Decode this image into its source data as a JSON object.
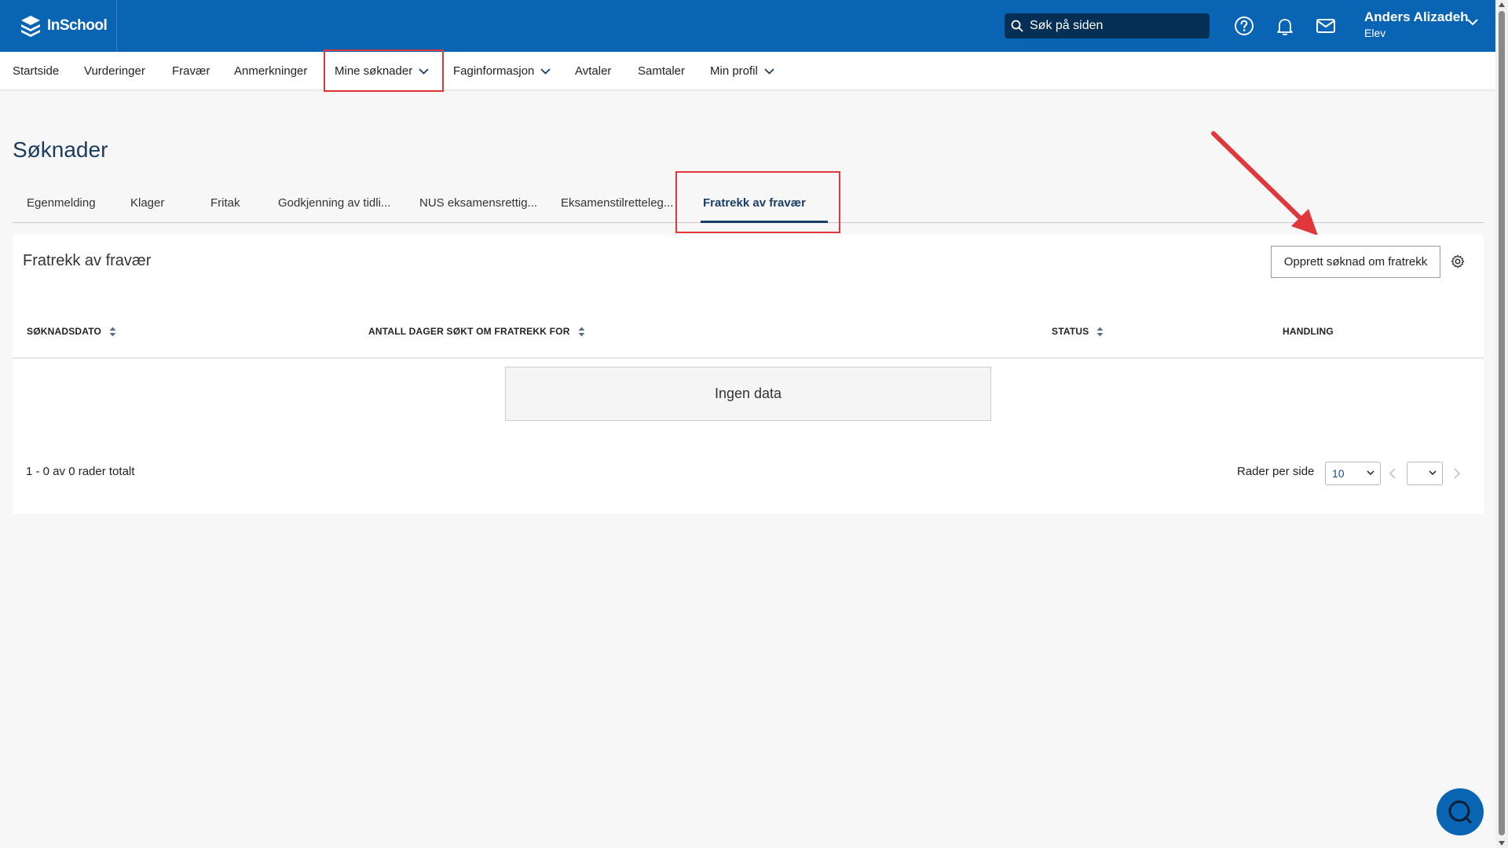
{
  "app": {
    "logo_text": "InSchool",
    "search_placeholder": "Søk på siden",
    "user_name": "Anders Alizadeh",
    "user_role": "Elev",
    "brand_color": "#0a64b4"
  },
  "nav": {
    "items": [
      {
        "label": "Startside"
      },
      {
        "label": "Vurderinger"
      },
      {
        "label": "Fravær"
      },
      {
        "label": "Anmerkninger"
      },
      {
        "label": "Mine søknader",
        "dropdown": true
      },
      {
        "label": "Faginformasjon",
        "dropdown": true
      },
      {
        "label": "Avtaler"
      },
      {
        "label": "Samtaler"
      },
      {
        "label": "Min profil",
        "dropdown": true
      }
    ]
  },
  "page": {
    "title": "Søknader",
    "tabs": [
      {
        "label": "Egenmelding"
      },
      {
        "label": "Klager"
      },
      {
        "label": "Fritak"
      },
      {
        "label": "Godkjenning av tidli..."
      },
      {
        "label": "NUS eksamensrettig..."
      },
      {
        "label": "Eksamenstilretteleg..."
      },
      {
        "label": "Fratrekk av fravær",
        "active": true
      }
    ]
  },
  "card": {
    "title": "Fratrekk av fravær",
    "create_button": "Opprett søknad om fratrekk",
    "columns": [
      {
        "label": "SØKNADSDATO",
        "sortable": true
      },
      {
        "label": "ANTALL DAGER SØKT OM FRATREKK FOR",
        "sortable": true
      },
      {
        "label": "STATUS",
        "sortable": true
      },
      {
        "label": "HANDLING",
        "sortable": false
      }
    ],
    "empty_text": "Ingen data",
    "rows_total": "1 - 0 av 0 rader totalt",
    "rows_per_page_label": "Rader per side",
    "rows_per_page_value": "10",
    "page_select_value": ""
  },
  "annotation_color": "#e0373b"
}
